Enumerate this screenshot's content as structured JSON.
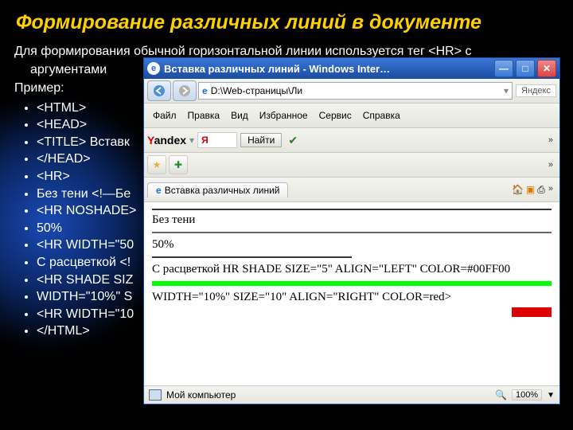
{
  "title": "Формирование различных линий в документе",
  "intro_line1": "Для формирования обычной горизонтальной линии используется тег <HR> с",
  "intro_line2": "аргументами",
  "example_label": "Пример:",
  "bullets": [
    "<HTML>",
    "<HEAD>",
    "<TITLE> Вставк",
    "</HEAD>",
    "<HR>",
    "Без тени <!—Бе",
    "<HR NOSHADE>",
    "50%",
    "<HR WIDTH=\"50",
    "С расцветкой <!",
    "<HR SHADE SIZ",
    "WIDTH=\"10%\" S",
    "<HR WIDTH=\"10",
    "</HTML>"
  ],
  "ie": {
    "title": "Вставка различных линий - Windows Inter…",
    "addr": "D:\\Web-страницы\\Ли",
    "addr_search_label": "Яндекс",
    "menu": [
      "Файл",
      "Правка",
      "Вид",
      "Избранное",
      "Сервис",
      "Справка"
    ],
    "yandex_brand": "Yandex",
    "yandex_y": "Я",
    "yandex_find": "Найти",
    "tab_label": "Вставка различных линий",
    "status_left": "Мой компьютер",
    "zoom": "100%",
    "content": {
      "no_shadow": "Без тени",
      "fifty": "50%",
      "shade_text": "С расцветкой HR SHADE SIZE=\"5\" ALIGN=\"LEFT\" COLOR=#00FF00",
      "red_text": "WIDTH=\"10%\" SIZE=\"10\" ALIGN=\"RIGHT\" COLOR=red>"
    }
  }
}
